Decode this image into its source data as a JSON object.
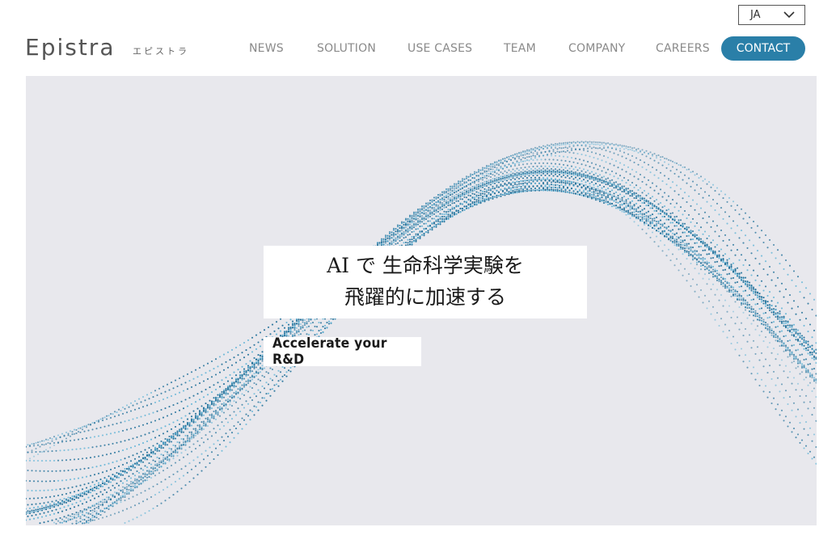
{
  "language_selector": {
    "value": "JA",
    "icon": "chevron-down-icon"
  },
  "brand": {
    "logo": "Epistra",
    "kana": "エピストラ"
  },
  "nav": {
    "items": [
      {
        "label": "NEWS"
      },
      {
        "label": "SOLUTION"
      },
      {
        "label": "USE CASES"
      },
      {
        "label": "TEAM"
      },
      {
        "label": "COMPANY"
      },
      {
        "label": "CAREERS"
      }
    ],
    "contact_label": "CONTACT"
  },
  "hero": {
    "headline_line1": "AI で 生命科学実験を",
    "headline_line2": "飛躍的に加速する",
    "tagline": "Accelerate your R&D"
  },
  "colors": {
    "accent": "#2a7fa8",
    "hero_background": "#e8e8ed",
    "wave_dark": "#1f6f99",
    "wave_light": "#5fb3d6",
    "nav_text": "#8a8a8a"
  }
}
